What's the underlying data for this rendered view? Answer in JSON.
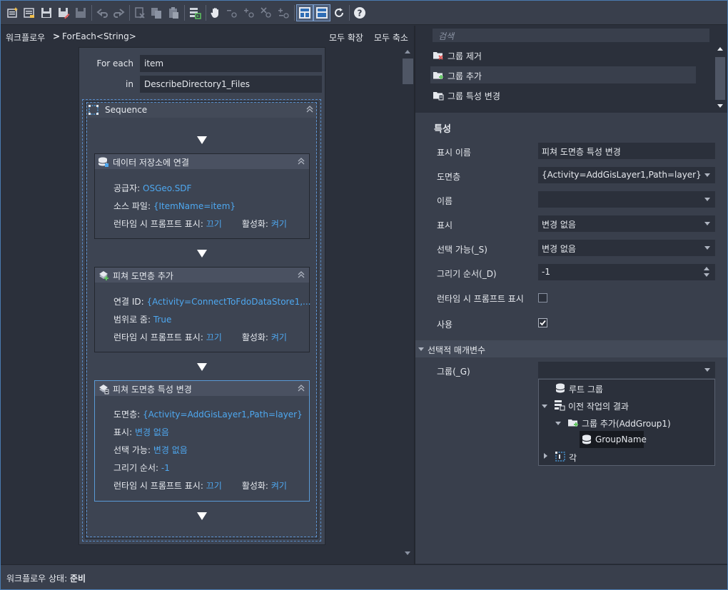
{
  "breadcrumb": {
    "root": "워크플로우",
    "separator": ">",
    "current": "ForEach<String>"
  },
  "canvas_actions": {
    "expand_all": "모두 확장",
    "collapse_all": "모두 축소"
  },
  "foreach": {
    "for_each_label": "For each",
    "for_each_value": "item",
    "in_label": "in",
    "in_value": "DescribeDirectory1_Files",
    "sequence_title": "Sequence"
  },
  "activities": [
    {
      "title": "데이터 저장소에 연결",
      "rows": [
        {
          "label": "공급자:",
          "value": "OSGeo.SDF"
        },
        {
          "label": "소스 파일:",
          "value": "{ItemName=item}"
        }
      ],
      "footer": {
        "prompt_label": "런타임 시 프롬프트 표시:",
        "prompt_value": "끄기",
        "enabled_label": "활성화:",
        "enabled_value": "켜기"
      }
    },
    {
      "title": "피쳐 도면층 추가",
      "rows": [
        {
          "label": "연결 ID:",
          "value": "{Activity=ConnectToFdoDataStore1,..."
        },
        {
          "label": "범위로 줌:",
          "value": "True"
        }
      ],
      "footer": {
        "prompt_label": "런타임 시 프롬프트 표시:",
        "prompt_value": "끄기",
        "enabled_label": "활성화:",
        "enabled_value": "켜기"
      }
    },
    {
      "title": "피쳐 도면층 특성 변경",
      "rows": [
        {
          "label": "도면층:",
          "value": "{Activity=AddGisLayer1,Path=layer}"
        },
        {
          "label": "표시:",
          "value": "변경 없음"
        },
        {
          "label": "선택 가능:",
          "value": "변경 없음"
        },
        {
          "label": "그리기 순서:",
          "value": "-1"
        }
      ],
      "footer": {
        "prompt_label": "런타임 시 프롬프트 표시:",
        "prompt_value": "끄기",
        "enabled_label": "활성화:",
        "enabled_value": "켜기"
      }
    }
  ],
  "activity_list": {
    "search_placeholder": "검색",
    "items": [
      "그룹 제거",
      "그룹 추가",
      "그룹 특성 변경"
    ]
  },
  "properties": {
    "title": "특성",
    "fields": [
      {
        "label": "표시 이름",
        "value": "피쳐 도면층 특성 변경"
      },
      {
        "label": "도면층",
        "value": "{Activity=AddGisLayer1,Path=layer}"
      },
      {
        "label": "이름",
        "value": ""
      },
      {
        "label": "표시",
        "value": "변경 없음"
      },
      {
        "label": "선택 가능(_S)",
        "value": "변경 없음"
      },
      {
        "label": "그리기 순서(_D)",
        "value": "-1"
      }
    ],
    "prompt_label": "런타임 시 프롬프트 표시",
    "prompt_checked": false,
    "use_label": "사용",
    "use_checked": true,
    "optional_section": "선택적 매개변수",
    "group_label": "그룹(_G)",
    "group_value": "",
    "tree": {
      "root_group": "루트 그룹",
      "previous_results": "이전 작업의 결과",
      "add_group": "그룹 추가(AddGroup1)",
      "group_name": "GroupName",
      "each": "각"
    }
  },
  "status": {
    "label": "워크플로우 상태:",
    "value": "준비"
  },
  "colors": {
    "accent": "#4ea8f0",
    "selection_border": "#5a9ad6",
    "panel": "#393f4c",
    "background": "#2b303b"
  }
}
